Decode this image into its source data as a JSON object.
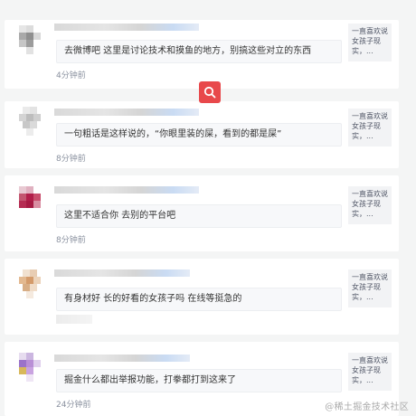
{
  "colors": {
    "background": "#f4f5f5",
    "card": "#ffffff",
    "accent": "#e8484b",
    "time_text": "#8a919f"
  },
  "search_button": {
    "icon": "search-icon"
  },
  "comments": [
    {
      "text": "去微博吧 这里是讨论技术和摸鱼的地方，别搞这些对立的东西",
      "time": "4分钟前",
      "preview": "一直喜欢说女孩子现实，..."
    },
    {
      "text": "一句粗话是这样说的，“你眼里装的屎，看到的都是屎”",
      "time": "8分钟前",
      "preview": "一直喜欢说女孩子现实，..."
    },
    {
      "text": "这里不适合你 去别的平台吧",
      "time": "8分钟前",
      "preview": "一直喜欢说女孩子现实，..."
    },
    {
      "text": "有身材好 长的好看的女孩子吗 在线等挺急的",
      "time": "",
      "preview": "一直喜欢说女孩子现实，..."
    },
    {
      "text": "掘金什么都出举报功能，打拳都打到这来了",
      "time": "24分钟前",
      "preview": "一直喜欢说女孩子现实，..."
    }
  ],
  "watermark": "@稀土掘金技术社区"
}
